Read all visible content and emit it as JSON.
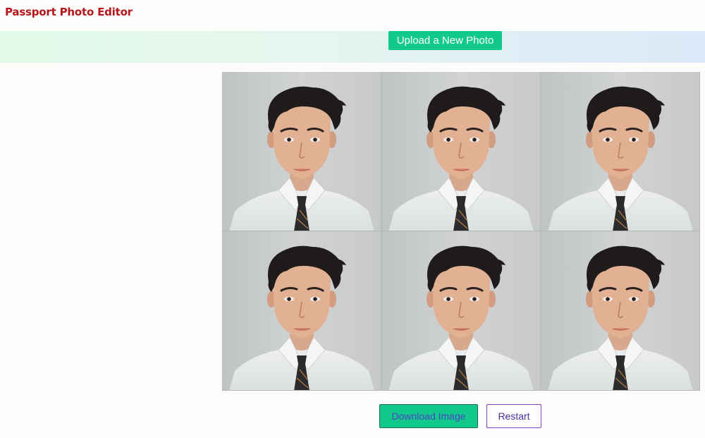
{
  "header": {
    "title": "Passport Photo Editor"
  },
  "upload": {
    "label": "Upload a New Photo"
  },
  "photo_sheet": {
    "rows": 2,
    "columns": 3,
    "tiles": [
      {
        "name": "passport-photo-1"
      },
      {
        "name": "passport-photo-2"
      },
      {
        "name": "passport-photo-3"
      },
      {
        "name": "passport-photo-4"
      },
      {
        "name": "passport-photo-5"
      },
      {
        "name": "passport-photo-6"
      }
    ]
  },
  "actions": {
    "download_label": "Download Image",
    "restart_label": "Restart"
  },
  "colors": {
    "title": "#b5161b",
    "accent_green": "#12c98c",
    "restart_border": "#8a3fc4"
  }
}
